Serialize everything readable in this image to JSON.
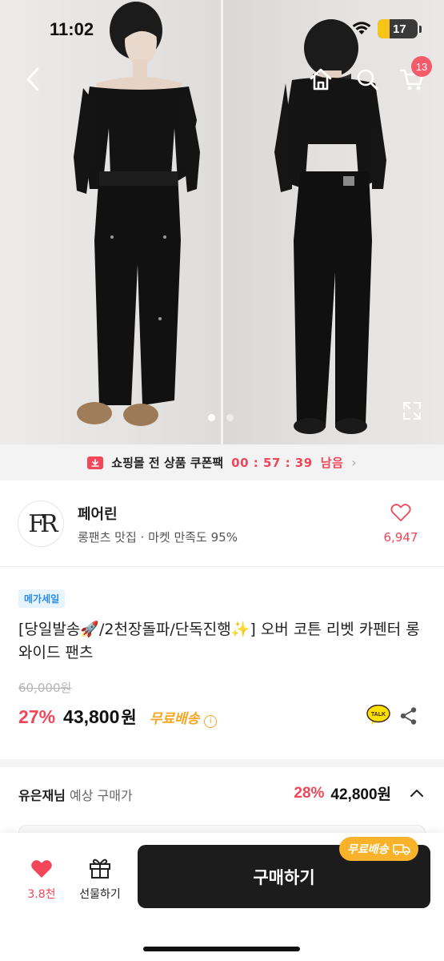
{
  "status": {
    "time": "11:02",
    "battery": "17"
  },
  "nav": {
    "cart_count": "13"
  },
  "gallery": {
    "images": [
      "model-front",
      "model-back"
    ],
    "active_index": 0
  },
  "coupon": {
    "text": "쇼핑몰 전 상품 쿠폰팩",
    "timer": "00 : 57 : 39",
    "suffix": "남음"
  },
  "seller": {
    "logo_text": "FR",
    "name": "페어린",
    "sub": "롱팬츠 맛집 · 마켓 만족도 95%",
    "likes": "6,947"
  },
  "product": {
    "badge": "메가세일",
    "title": "[당일발송🚀/2천장돌파/단독진행✨] 오버 코튼 리벳 카펜터 롱 와이드 팬츠",
    "original_price": "60,000원",
    "discount": "27%",
    "price": "43,800",
    "price_unit": "원",
    "free_shipping": "무료배송"
  },
  "talk": {
    "label": "TALK"
  },
  "expected": {
    "user": "유은재님",
    "label": " 예상 구매가",
    "rate": "28%",
    "price": "42,800원"
  },
  "bottom": {
    "likes": "3.8천",
    "gift_label": "선물하기",
    "buy_label": "구매하기",
    "ship_tag": "무료배송"
  },
  "colors": {
    "accent": "#f0475a",
    "ship": "#f5a623",
    "buy": "#1c1c1c"
  }
}
